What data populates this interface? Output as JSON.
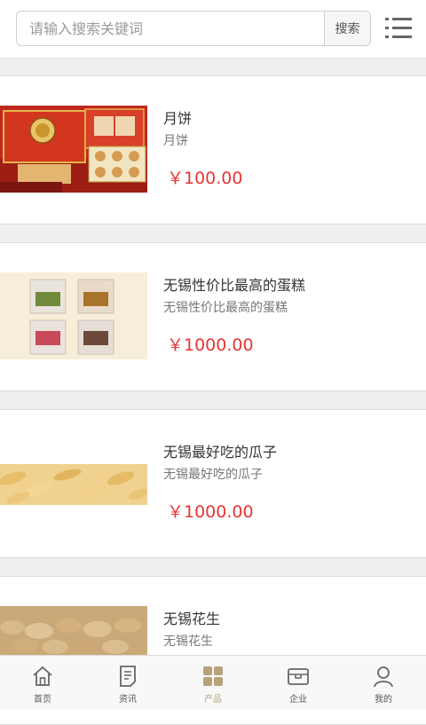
{
  "search": {
    "placeholder": "请输入搜索关键词",
    "button_label": "搜索"
  },
  "products": [
    {
      "name": "月饼",
      "desc": "月饼",
      "price": "￥100.00"
    },
    {
      "name": "无锡性价比最高的蛋糕",
      "desc": "无锡性价比最高的蛋糕",
      "price": "￥1000.00"
    },
    {
      "name": "无锡最好吃的瓜子",
      "desc": "无锡最好吃的瓜子",
      "price": "￥1000.00"
    },
    {
      "name": "无锡花生",
      "desc": "无锡花生",
      "price": ""
    }
  ],
  "tabs": [
    {
      "label": "首页",
      "icon": "home-icon"
    },
    {
      "label": "资讯",
      "icon": "news-icon"
    },
    {
      "label": "产品",
      "icon": "grid-icon",
      "active": true
    },
    {
      "label": "企业",
      "icon": "company-icon"
    },
    {
      "label": "我的",
      "icon": "user-icon"
    }
  ],
  "colors": {
    "price": "#e43636",
    "active_tab": "#b8a27a"
  }
}
